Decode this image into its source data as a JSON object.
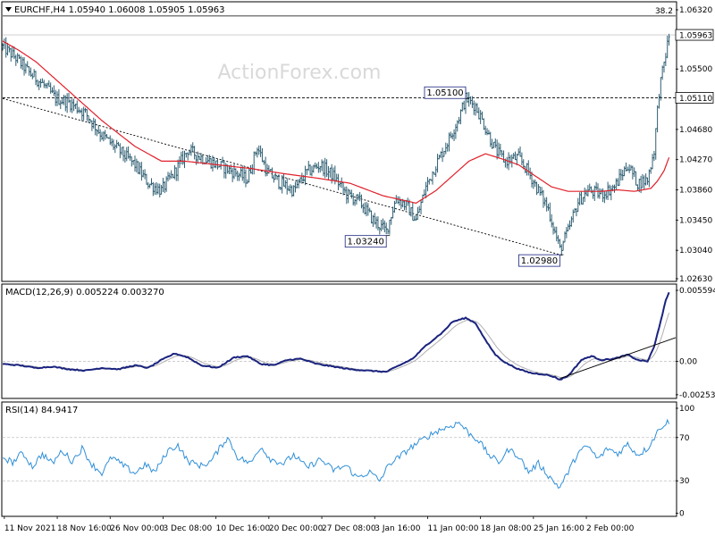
{
  "watermark": "ActionForex.com",
  "colors": {
    "candle": "#2f5f73",
    "ma": "#e0202a",
    "macd": "#1a237e",
    "signal": "#b0b0b0",
    "rsi": "#2f8fd8",
    "axis": "#000000",
    "grid": "#bfbfbf",
    "watermark": "#d9d9d9"
  },
  "price_panel": {
    "header": "EURCHF,H4  1.05940 1.06008 1.05905 1.05963",
    "ylim": [
      1.0263,
      1.064
    ],
    "ticks": [
      "1.06320",
      "1.05500",
      "1.04680",
      "1.04270",
      "1.03860",
      "1.03450",
      "1.03040",
      "1.02630"
    ],
    "tick_values": [
      1.0632,
      1.055,
      1.0468,
      1.0427,
      1.0386,
      1.0345,
      1.0304,
      1.0263
    ],
    "fib_label": "38.2",
    "fib_level": 1.0622,
    "current_price": "1.05963",
    "current_value": 1.05963,
    "level_price": "1.05110",
    "level_value": 1.0511,
    "annotations": [
      {
        "text": "1.05100",
        "bar": 280,
        "value": 1.051,
        "anchor": "top"
      },
      {
        "text": "1.03240",
        "bar": 232,
        "value": 1.0324,
        "anchor": "bottom"
      },
      {
        "text": "1.02980",
        "bar": 337,
        "value": 1.0298,
        "anchor": "bottom"
      }
    ]
  },
  "macd_panel": {
    "header": "MACD(12,26,9) 0.005224 0.003270",
    "ylim": [
      -0.00275,
      0.0058
    ],
    "ticks": [
      "0.005594",
      "0.00",
      "-0.002538"
    ],
    "tick_values": [
      0.005594,
      0.0,
      -0.002538
    ]
  },
  "rsi_panel": {
    "header": "RSI(14) 84.9417",
    "ylim": [
      -2,
      102
    ],
    "ticks": [
      "100",
      "70",
      "30",
      "0"
    ],
    "tick_values": [
      100,
      70,
      30,
      0
    ]
  },
  "x_axis": {
    "labels": [
      "11 Nov 2021",
      "18 Nov 16:00",
      "26 Nov 00:00",
      "3 Dec 08:00",
      "10 Dec 16:00",
      "20 Dec 00:00",
      "27 Dec 08:00",
      "3 Jan 16:00",
      "11 Jan 00:00",
      "18 Jan 08:00",
      "25 Jan 16:00",
      "2 Feb 00:00"
    ],
    "label_bars": [
      1,
      33,
      65,
      97,
      129,
      161,
      193,
      225,
      257,
      289,
      321,
      353
    ]
  },
  "chart_data": {
    "type": "candlestick",
    "symbol": "EURCHF",
    "timeframe": "H4",
    "bar_count": 399,
    "first_bar_time": "11 Nov 2021",
    "last_close": 1.05963,
    "keypoints": [
      [
        0,
        1.058
      ],
      [
        8,
        1.0565
      ],
      [
        16,
        1.0545
      ],
      [
        24,
        1.053
      ],
      [
        32,
        1.051
      ],
      [
        40,
        1.0505
      ],
      [
        50,
        1.049
      ],
      [
        60,
        1.046
      ],
      [
        70,
        1.044
      ],
      [
        80,
        1.042
      ],
      [
        88,
        1.0395
      ],
      [
        96,
        1.0385
      ],
      [
        104,
        1.041
      ],
      [
        112,
        1.044
      ],
      [
        120,
        1.043
      ],
      [
        130,
        1.042
      ],
      [
        140,
        1.041
      ],
      [
        148,
        1.04
      ],
      [
        154,
        1.0445
      ],
      [
        160,
        1.041
      ],
      [
        168,
        1.0395
      ],
      [
        176,
        1.0385
      ],
      [
        184,
        1.041
      ],
      [
        192,
        1.042
      ],
      [
        200,
        1.0405
      ],
      [
        208,
        1.038
      ],
      [
        216,
        1.037
      ],
      [
        224,
        1.0345
      ],
      [
        232,
        1.033
      ],
      [
        238,
        1.0375
      ],
      [
        244,
        1.0365
      ],
      [
        250,
        1.0345
      ],
      [
        256,
        1.039
      ],
      [
        262,
        1.042
      ],
      [
        270,
        1.0455
      ],
      [
        276,
        1.0485
      ],
      [
        280,
        1.051
      ],
      [
        286,
        1.05
      ],
      [
        292,
        1.047
      ],
      [
        298,
        1.044
      ],
      [
        304,
        1.0425
      ],
      [
        312,
        1.043
      ],
      [
        318,
        1.041
      ],
      [
        324,
        1.0385
      ],
      [
        330,
        1.036
      ],
      [
        337,
        1.0305
      ],
      [
        342,
        1.033
      ],
      [
        348,
        1.037
      ],
      [
        354,
        1.0385
      ],
      [
        362,
        1.038
      ],
      [
        370,
        1.039
      ],
      [
        378,
        1.042
      ],
      [
        384,
        1.0395
      ],
      [
        390,
        1.04
      ],
      [
        394,
        1.044
      ],
      [
        397,
        1.052
      ],
      [
        399,
        1.0545
      ],
      [
        403,
        1.0595
      ]
    ],
    "moving_average_keypoints": [
      [
        0,
        1.0588
      ],
      [
        10,
        1.0575
      ],
      [
        20,
        1.056
      ],
      [
        40,
        1.052
      ],
      [
        60,
        1.048
      ],
      [
        80,
        1.0445
      ],
      [
        96,
        1.0425
      ],
      [
        110,
        1.0425
      ],
      [
        130,
        1.042
      ],
      [
        150,
        1.0415
      ],
      [
        170,
        1.0408
      ],
      [
        190,
        1.0402
      ],
      [
        210,
        1.0395
      ],
      [
        230,
        1.0378
      ],
      [
        250,
        1.0368
      ],
      [
        262,
        1.0385
      ],
      [
        272,
        1.0405
      ],
      [
        282,
        1.0425
      ],
      [
        292,
        1.0435
      ],
      [
        302,
        1.0428
      ],
      [
        312,
        1.042
      ],
      [
        322,
        1.0405
      ],
      [
        332,
        1.039
      ],
      [
        342,
        1.0384
      ],
      [
        352,
        1.0384
      ],
      [
        362,
        1.0384
      ],
      [
        372,
        1.0386
      ],
      [
        382,
        1.0384
      ],
      [
        392,
        1.0388
      ],
      [
        396,
        1.0398
      ],
      [
        400,
        1.0412
      ],
      [
        403,
        1.043
      ]
    ],
    "trendlines": [
      {
        "from": [
          0,
          1.051
        ],
        "to": [
          337,
          1.0298
        ],
        "style": "dotted"
      }
    ],
    "horizontal_levels": [
      1.0511,
      1.0622
    ],
    "macd": {
      "params": "12,26,9",
      "value": 0.005224,
      "signal": 0.00327,
      "keypoints": [
        [
          0,
          -0.0002
        ],
        [
          10,
          -0.0003
        ],
        [
          20,
          -0.0005
        ],
        [
          30,
          -0.0004
        ],
        [
          40,
          -0.0006
        ],
        [
          50,
          -0.0007
        ],
        [
          60,
          -0.0005
        ],
        [
          70,
          -0.0006
        ],
        [
          80,
          -0.0003
        ],
        [
          88,
          -0.0005
        ],
        [
          96,
          0.0001
        ],
        [
          104,
          0.0006
        ],
        [
          112,
          0.0003
        ],
        [
          120,
          -0.0003
        ],
        [
          130,
          -0.0005
        ],
        [
          140,
          0.0003
        ],
        [
          148,
          0.0004
        ],
        [
          156,
          -0.0002
        ],
        [
          164,
          -0.0003
        ],
        [
          172,
          0.0001
        ],
        [
          180,
          0.0002
        ],
        [
          190,
          -0.0002
        ],
        [
          200,
          -0.0004
        ],
        [
          210,
          -0.0006
        ],
        [
          220,
          -0.0007
        ],
        [
          232,
          -0.0008
        ],
        [
          240,
          -0.0003
        ],
        [
          248,
          0.0002
        ],
        [
          256,
          0.0012
        ],
        [
          266,
          0.0022
        ],
        [
          272,
          0.003
        ],
        [
          280,
          0.0033
        ],
        [
          286,
          0.0029
        ],
        [
          292,
          0.0016
        ],
        [
          298,
          0.0005
        ],
        [
          304,
          -0.0001
        ],
        [
          312,
          -0.0006
        ],
        [
          320,
          -0.0009
        ],
        [
          328,
          -0.001
        ],
        [
          334,
          -0.0012
        ],
        [
          337,
          -0.0014
        ],
        [
          342,
          -0.0011
        ],
        [
          350,
          0.0001
        ],
        [
          356,
          0.0004
        ],
        [
          362,
          0.0001
        ],
        [
          370,
          0.0002
        ],
        [
          378,
          0.0005
        ],
        [
          384,
          0.0001
        ],
        [
          390,
          0.0
        ],
        [
          394,
          0.0011
        ],
        [
          398,
          0.0031
        ],
        [
          401,
          0.0046
        ],
        [
          403,
          0.0052
        ]
      ],
      "trendline": {
        "from": [
          337,
          -0.0013
        ],
        "to": [
          403,
          0.0018
        ]
      }
    },
    "rsi": {
      "period": 14,
      "value": 84.9417,
      "levels": [
        70,
        30
      ],
      "keypoints": [
        [
          0,
          52
        ],
        [
          6,
          47
        ],
        [
          12,
          56
        ],
        [
          18,
          43
        ],
        [
          24,
          55
        ],
        [
          30,
          46
        ],
        [
          36,
          58
        ],
        [
          42,
          48
        ],
        [
          48,
          60
        ],
        [
          54,
          45
        ],
        [
          60,
          37
        ],
        [
          66,
          52
        ],
        [
          72,
          45
        ],
        [
          80,
          37
        ],
        [
          86,
          45
        ],
        [
          92,
          38
        ],
        [
          100,
          58
        ],
        [
          106,
          63
        ],
        [
          112,
          48
        ],
        [
          120,
          44
        ],
        [
          126,
          48
        ],
        [
          132,
          62
        ],
        [
          136,
          70
        ],
        [
          142,
          52
        ],
        [
          150,
          46
        ],
        [
          156,
          62
        ],
        [
          162,
          50
        ],
        [
          170,
          46
        ],
        [
          176,
          54
        ],
        [
          184,
          42
        ],
        [
          192,
          50
        ],
        [
          200,
          40
        ],
        [
          208,
          44
        ],
        [
          214,
          33
        ],
        [
          222,
          38
        ],
        [
          228,
          30
        ],
        [
          234,
          46
        ],
        [
          240,
          52
        ],
        [
          246,
          60
        ],
        [
          252,
          66
        ],
        [
          258,
          72
        ],
        [
          264,
          77
        ],
        [
          270,
          80
        ],
        [
          276,
          84
        ],
        [
          282,
          74
        ],
        [
          288,
          67
        ],
        [
          294,
          54
        ],
        [
          300,
          47
        ],
        [
          306,
          59
        ],
        [
          312,
          53
        ],
        [
          318,
          38
        ],
        [
          324,
          46
        ],
        [
          330,
          35
        ],
        [
          334,
          28
        ],
        [
          337,
          24
        ],
        [
          342,
          38
        ],
        [
          348,
          56
        ],
        [
          354,
          62
        ],
        [
          360,
          50
        ],
        [
          366,
          60
        ],
        [
          372,
          55
        ],
        [
          378,
          64
        ],
        [
          384,
          54
        ],
        [
          390,
          60
        ],
        [
          394,
          70
        ],
        [
          398,
          80
        ],
        [
          401,
          83
        ],
        [
          403,
          85
        ]
      ]
    }
  }
}
